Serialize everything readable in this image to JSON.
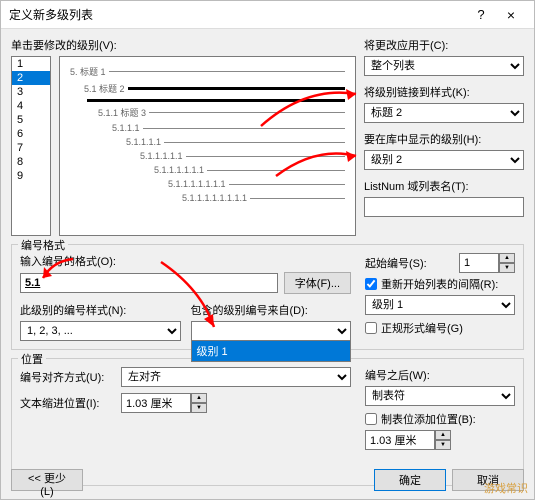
{
  "titlebar": {
    "title": "定义新多级列表"
  },
  "top": {
    "level_label": "单击要修改的级别(V):",
    "levels": [
      "1",
      "2",
      "3",
      "4",
      "5",
      "6",
      "7",
      "8",
      "9"
    ],
    "selected_level": "2",
    "preview": [
      {
        "indent": 0,
        "num": "5.",
        "label": "标题 1",
        "thick": false
      },
      {
        "indent": 1,
        "num": "5.1",
        "label": "标题 2",
        "thick": true
      },
      {
        "indent": 1,
        "num": "",
        "label": "",
        "thick": true
      },
      {
        "indent": 2,
        "num": "5.1.1",
        "label": "标题 3",
        "thick": false
      },
      {
        "indent": 3,
        "num": "5.1.1.1",
        "label": "",
        "thick": false
      },
      {
        "indent": 4,
        "num": "5.1.1.1.1",
        "label": "",
        "thick": false
      },
      {
        "indent": 5,
        "num": "5.1.1.1.1.1",
        "label": "",
        "thick": false
      },
      {
        "indent": 6,
        "num": "5.1.1.1.1.1.1",
        "label": "",
        "thick": false
      },
      {
        "indent": 7,
        "num": "5.1.1.1.1.1.1.1",
        "label": "",
        "thick": false
      },
      {
        "indent": 8,
        "num": "5.1.1.1.1.1.1.1.1",
        "label": "",
        "thick": false
      }
    ]
  },
  "right": {
    "apply_to_label": "将更改应用于(C):",
    "apply_to_value": "整个列表",
    "link_style_label": "将级别链接到样式(K):",
    "link_style_value": "标题 2",
    "gallery_label": "要在库中显示的级别(H):",
    "gallery_value": "级别 2",
    "listnum_label": "ListNum 域列表名(T):",
    "listnum_value": ""
  },
  "format_group": {
    "title": "编号格式",
    "enter_format_label": "输入编号的格式(O):",
    "enter_format_value": "5.1",
    "font_button": "字体(F)...",
    "number_style_label": "此级别的编号样式(N):",
    "number_style_value": "1, 2, 3, ...",
    "include_from_label": "包含的级别编号来自(D):",
    "include_from_value": "",
    "dropdown_item": "级别 1",
    "start_at_label": "起始编号(S):",
    "start_at_value": "1",
    "restart_after_label": "重新开始列表的间隔(R):",
    "restart_after_checked": true,
    "restart_after_value": "级别 1",
    "legal_style_label": "正规形式编号(G)",
    "legal_style_checked": false
  },
  "position_group": {
    "title": "位置",
    "align_label": "编号对齐方式(U):",
    "align_value": "左对齐",
    "indent_label": "文本缩进位置(I):",
    "indent_value": "1.03 厘米",
    "tab_after_label": "编号之后(W):",
    "tab_after_value": "制表符",
    "tab_stop_label": "制表位添加位置(B):",
    "tab_stop_checked": false,
    "tab_stop_value": "1.03 厘米"
  },
  "footer": {
    "less": "<< 更少(L)",
    "ok": "确定",
    "cancel": "取消"
  },
  "watermark": "游戏常识"
}
